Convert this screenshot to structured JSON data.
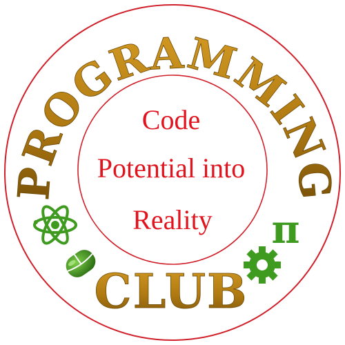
{
  "logo": {
    "arc_title": "PROGRAMMING",
    "bottom_title": "CLUB",
    "motto_lines": [
      "Code",
      "Potential into",
      "Reality"
    ],
    "pi_symbol": "π"
  },
  "colors": {
    "ring": "#d11f2a",
    "title": "#b07a12",
    "title_dark": "#7a5208",
    "motto": "#e0141e",
    "icon_green": "#3f9b1f",
    "icon_green_dark": "#2c6e14"
  },
  "icons": {
    "left_upper": "atom-icon",
    "left_lower": "computer-mouse-icon",
    "right_upper": "pi-icon",
    "right_lower": "gear-icon"
  }
}
